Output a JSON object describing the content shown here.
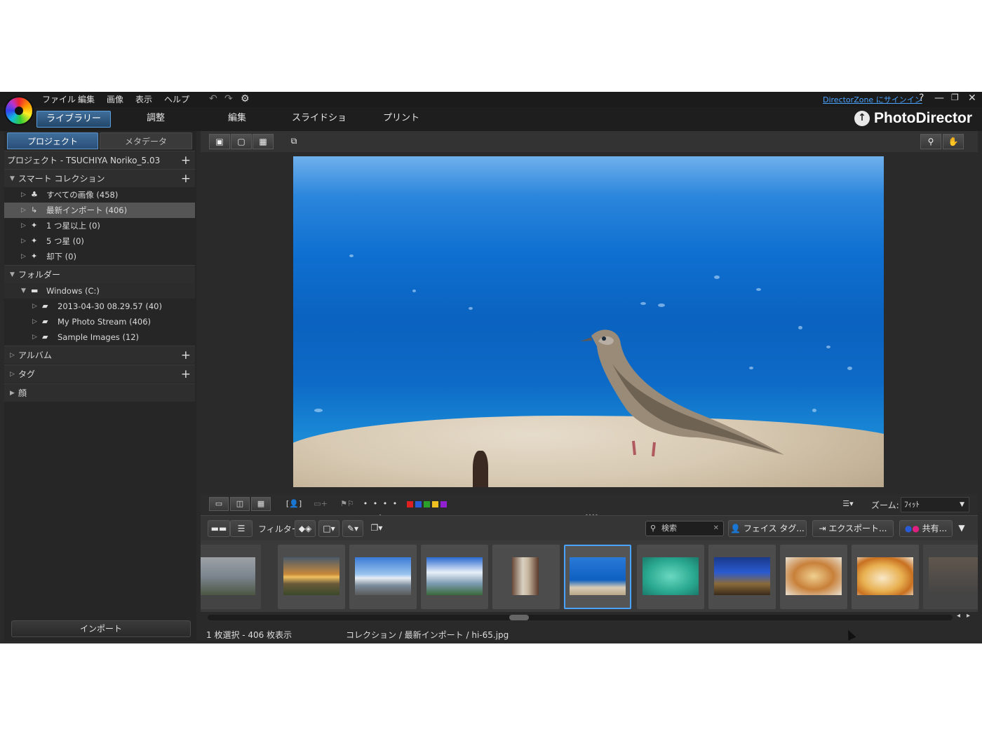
{
  "menu": [
    "ファイル",
    "編集",
    "画像",
    "表示",
    "ヘルプ"
  ],
  "titlebar": {
    "signin": "DirectorZone にサインイン",
    "help": "?",
    "minimize": "—",
    "restore": "❐",
    "close": "✕"
  },
  "modules": [
    "ライブラリー",
    "調整",
    "編集",
    "スライドショー",
    "プリント"
  ],
  "brand": "PhotoDirector",
  "left_tabs": {
    "project": "プロジェクト",
    "metadata": "メタデータ"
  },
  "project_title": "プロジェクト - TSUCHIYA Noriko_5.03",
  "smart_collection": {
    "title": "スマート コレクション",
    "items": [
      {
        "label": "すべての画像 (458)"
      },
      {
        "label": "最新インポート (406)"
      },
      {
        "label": "1 つ星以上 (0)"
      },
      {
        "label": "5 つ星 (0)"
      },
      {
        "label": "却下 (0)"
      }
    ]
  },
  "folders": {
    "title": "フォルダー",
    "drive": "Windows (C:)",
    "items": [
      {
        "label": "2013-04-30 08.29.57 (40)"
      },
      {
        "label": "My Photo Stream (406)"
      },
      {
        "label": "Sample Images (12)"
      }
    ]
  },
  "album": "アルバム",
  "tag": "タグ",
  "face": "顔",
  "import_button": "インポート",
  "zoom": {
    "label": "ズーム:",
    "value": "ﾌｨｯﾄ"
  },
  "filter_label": "フィルター:",
  "search_placeholder": "検索",
  "buttons": {
    "face_tag": "フェイス タグ...",
    "export": "エクスポート...",
    "share": "共有..."
  },
  "status": {
    "selection": "1 枚選択 - 406 枚表示",
    "path": "コレクション / 最新インポート / hi-65.jpg"
  },
  "colors": {
    "accent": "#4aa3ff",
    "labels": [
      "#e02020",
      "#2a5bd6",
      "#2aa02a",
      "#f0c020",
      "#9020d0"
    ]
  }
}
